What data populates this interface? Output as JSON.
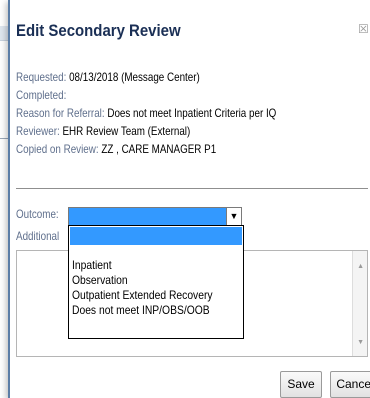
{
  "dialog": {
    "title": "Edit Secondary Review",
    "close_glyph": "☒"
  },
  "info": {
    "requested_label": "Requested:",
    "requested_value": "08/13/2018 (Message Center)",
    "completed_label": "Completed:",
    "completed_value": "",
    "reason_label": "Reason for Referral:",
    "reason_value": "Does not meet Inpatient Criteria per IQ",
    "reviewer_label": "Reviewer:",
    "reviewer_value": "EHR Review Team (External)",
    "copied_label": "Copied on Review:",
    "copied_value": "ZZ , CARE MANAGER P1"
  },
  "form": {
    "outcome_label": "Outcome:",
    "outcome_value": "",
    "additional_label": "Additional",
    "dropdown_arrow": "▼",
    "options": [
      "Inpatient",
      "Observation",
      "Outpatient Extended Recovery",
      "Does not meet INP/OBS/OOB"
    ]
  },
  "buttons": {
    "save": "Save",
    "cancel": "Cancel"
  },
  "colors": {
    "title": "#1a2f55",
    "label": "#5f6f8c",
    "selection": "#3399ff",
    "dialog_border": "#5b7da6"
  }
}
